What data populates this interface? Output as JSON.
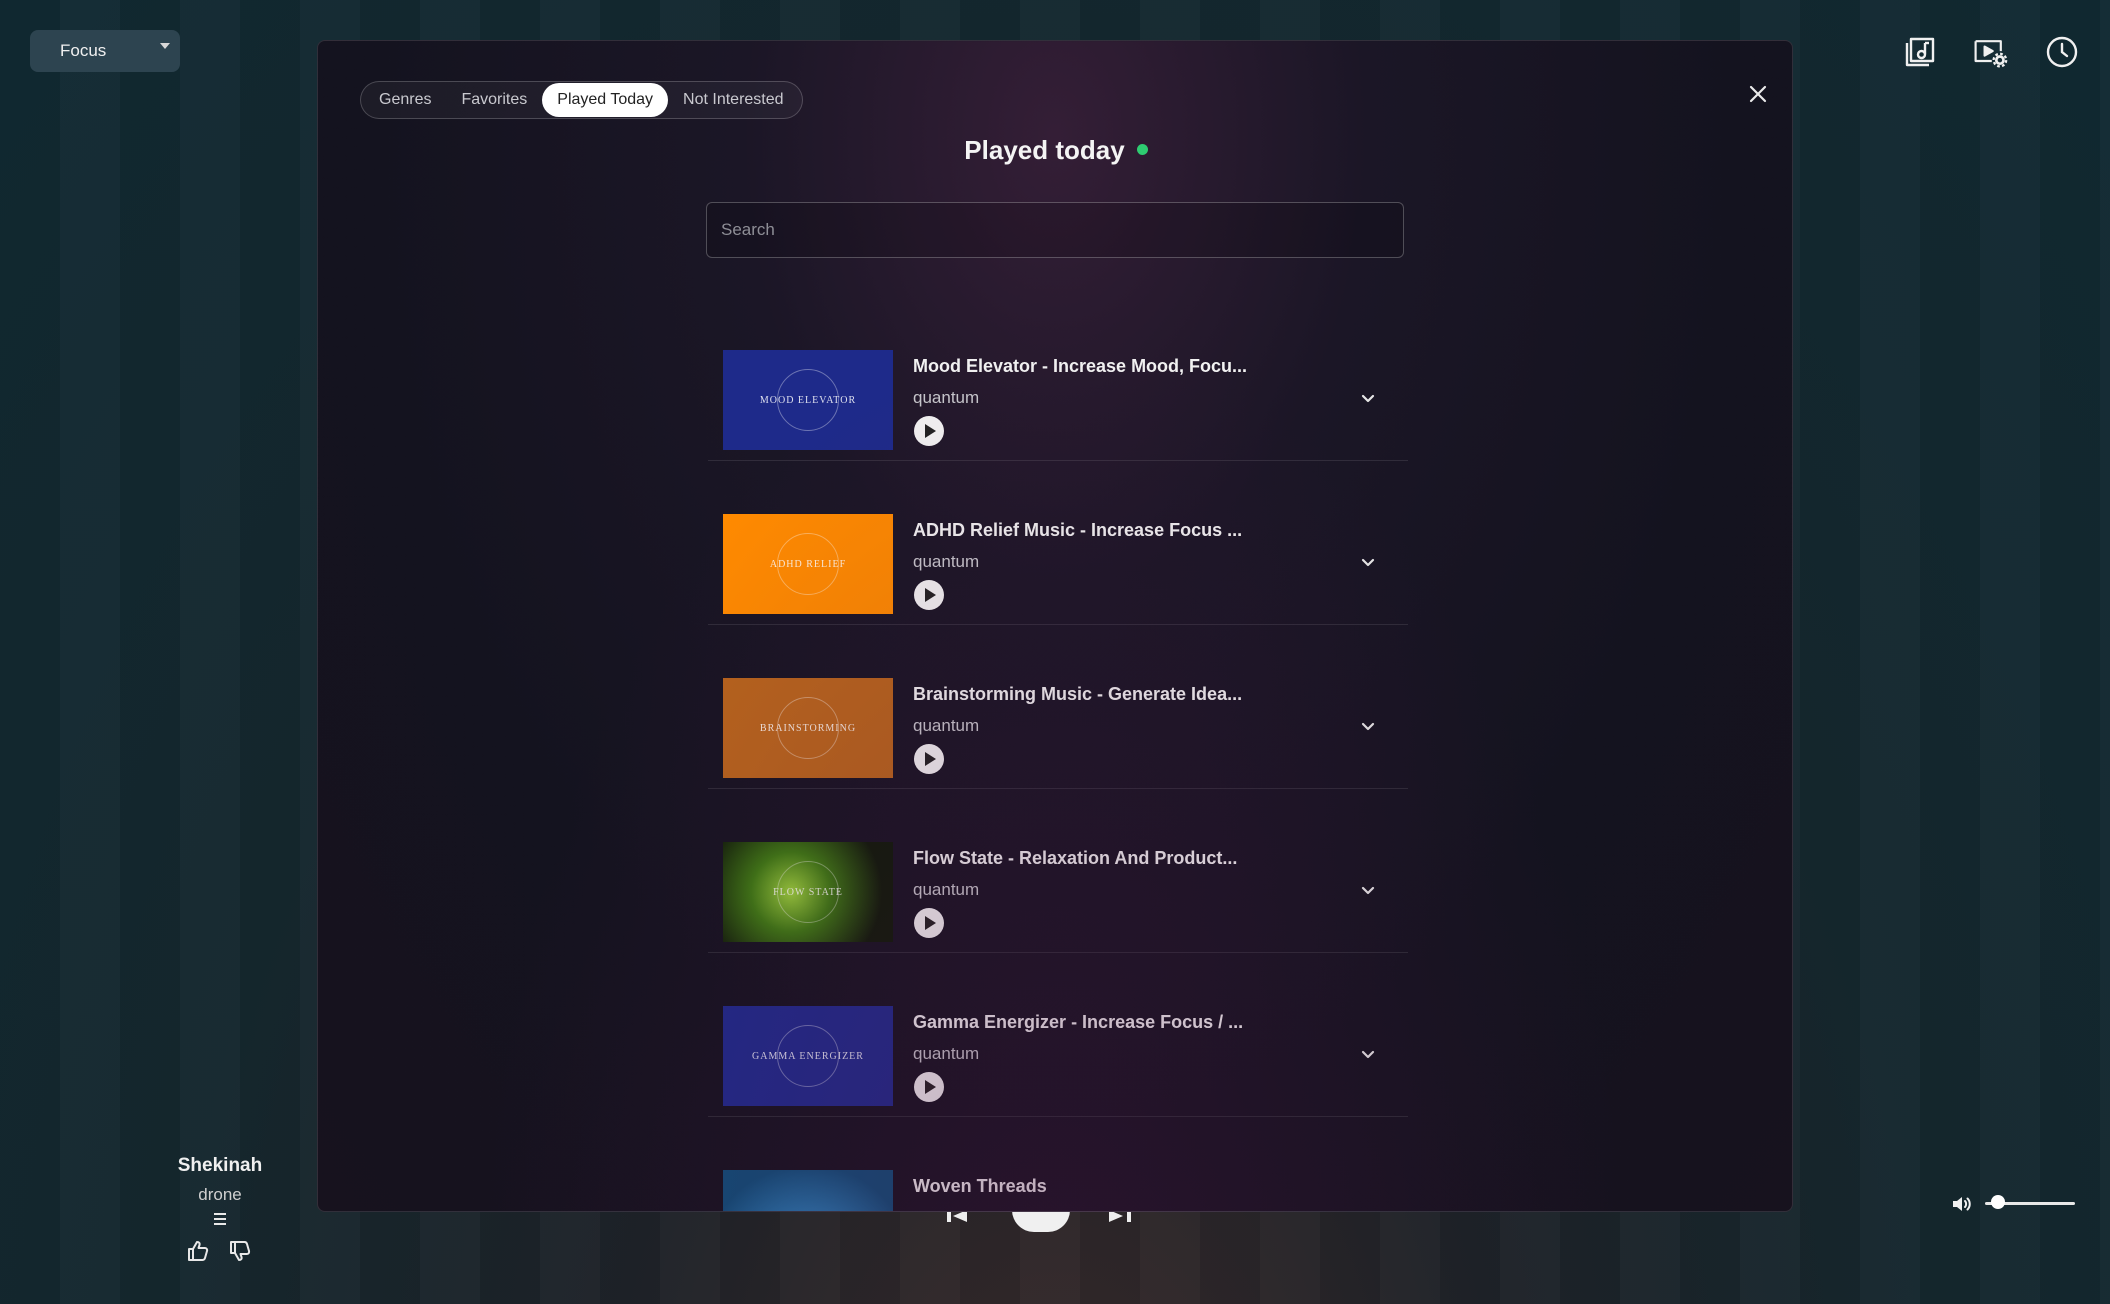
{
  "mode_select": {
    "label": "Focus"
  },
  "top_icons": [
    "music-library-icon",
    "video-settings-icon",
    "clock-icon"
  ],
  "modal": {
    "tabs": [
      {
        "label": "Genres",
        "active": false
      },
      {
        "label": "Favorites",
        "active": false
      },
      {
        "label": "Played Today",
        "active": true
      },
      {
        "label": "Not Interested",
        "active": false
      }
    ],
    "title": "Played today",
    "status_color": "#2ecc71",
    "search": {
      "placeholder": "Search",
      "value": ""
    },
    "tracks": [
      {
        "title": "Mood Elevator - Increase Mood, Focu...",
        "artist": "quantum",
        "thumb_text": "Mood Elevator",
        "thumb_color": "#1e2a8a"
      },
      {
        "title": "ADHD Relief Music - Increase Focus ...",
        "artist": "quantum",
        "thumb_text": "ADHD Relief",
        "thumb_color": "#ff8a00"
      },
      {
        "title": "Brainstorming Music - Generate Idea...",
        "artist": "quantum",
        "thumb_text": "Brainstorming",
        "thumb_color": "#b8641c"
      },
      {
        "title": "Flow State - Relaxation And Product...",
        "artist": "quantum",
        "thumb_text": "Flow State",
        "thumb_color": "#2f5a14"
      },
      {
        "title": "Gamma Energizer - Increase Focus / ...",
        "artist": "quantum",
        "thumb_text": "Gamma Energizer",
        "thumb_color": "#1e2a8a"
      },
      {
        "title": "Woven Threads",
        "artist": "",
        "thumb_text": "",
        "thumb_color": "#1e5f8a"
      }
    ]
  },
  "now_playing": {
    "title": "Shekinah",
    "artist": "drone"
  },
  "volume": 0.05
}
